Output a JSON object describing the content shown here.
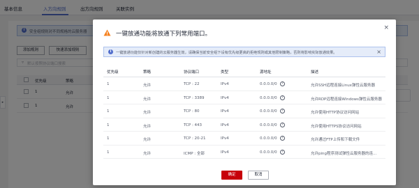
{
  "background": {
    "tabs": [
      {
        "label": "基本信息"
      },
      {
        "label": "入方向规则"
      },
      {
        "label": "出方向规则"
      },
      {
        "label": "关联实例"
      }
    ],
    "alert_text": "安全组规则对不同规格的云服务器",
    "buttons": [
      {
        "label": "添加规则"
      },
      {
        "label": "快速添加规则"
      }
    ],
    "search_placeholder": "默认按照协议端口搜索",
    "columns": [
      "优先级",
      "策略"
    ],
    "rows": [
      {
        "priority": "1",
        "policy": "允许"
      },
      {
        "priority": "1",
        "policy": "允许"
      }
    ]
  },
  "modal": {
    "title": "一键放通功能将放通下列常用端口。",
    "info_text": "一键放通功能仅针对新创建的云服务器生效，请确保当前安全组下设有优先级更高的拒绝规则或其他限制策略，否则将影响实际放通效果。",
    "columns": [
      "优先级",
      "策略",
      "协议端口",
      "类型",
      "源地址",
      "描述"
    ],
    "rows": [
      {
        "priority": "1",
        "policy": "允许",
        "port": "TCP : 22",
        "type": "IPv4",
        "source": "0.0.0.0/0",
        "desc": "允许SSH远程连接Linux弹性云服务器"
      },
      {
        "priority": "1",
        "policy": "允许",
        "port": "TCP : 3389",
        "type": "IPv4",
        "source": "0.0.0.0/0",
        "desc": "允许RDP远程连接Windows弹性云服务器"
      },
      {
        "priority": "1",
        "policy": "允许",
        "port": "TCP : 80",
        "type": "IPv4",
        "source": "0.0.0.0/0",
        "desc": "允许使用HTTP协议访问网站"
      },
      {
        "priority": "1",
        "policy": "允许",
        "port": "TCP : 443",
        "type": "IPv4",
        "source": "0.0.0.0/0",
        "desc": "允许使用HTTPS协议访问网站"
      },
      {
        "priority": "1",
        "policy": "允许",
        "port": "TCP : 20-21",
        "type": "IPv4",
        "source": "0.0.0.0/0",
        "desc": "允许通过FTP上传和下载文件"
      },
      {
        "priority": "1",
        "policy": "允许",
        "port": "ICMP : 全部",
        "type": "IPv4",
        "source": "0.0.0.0/0",
        "desc": "允许ping程序测试弹性云服务器的连..."
      }
    ],
    "ok_label": "确定",
    "cancel_label": "取消"
  },
  "colors": {
    "primary": "#526ecc",
    "danger": "#c7000b",
    "warning": "#f58220",
    "info_bg": "#e5ecf9"
  }
}
